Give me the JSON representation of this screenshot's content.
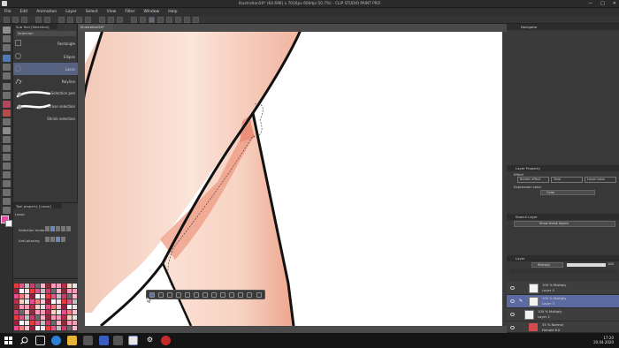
{
  "window": {
    "title": "Illustration50* (64.69K) x 7016px 600dpi 50.7%) - CLIP STUDIO PAINT PRO",
    "controls": [
      "—",
      "□",
      "✕"
    ]
  },
  "menu": [
    "File",
    "Edit",
    "Animation",
    "Layer",
    "Select",
    "View",
    "Filter",
    "Window",
    "Help"
  ],
  "document_tab": "Illustration50*",
  "sub_tool": {
    "tab_label": "Sub Tool [Selection]",
    "header": "Selection",
    "items": [
      {
        "label": "Rectangle",
        "icon": "rectangle-select-icon"
      },
      {
        "label": "Ellipse",
        "icon": "ellipse-select-icon"
      },
      {
        "label": "Lasso",
        "icon": "lasso-select-icon"
      },
      {
        "label": "Polyline",
        "icon": "polyline-select-icon"
      },
      {
        "label": "Selection pen",
        "icon": "selection-pen-icon"
      },
      {
        "label": "Erase selection",
        "icon": "erase-selection-icon"
      },
      {
        "label": "Shrink selection",
        "icon": "shrink-selection-icon"
      }
    ],
    "selected_index": 2
  },
  "tool_property": {
    "tab_label": "Tool property [Lasso]",
    "header": "Lasso",
    "rows": [
      {
        "label": "Selection mode"
      },
      {
        "label": "Anti-aliasing"
      }
    ]
  },
  "right_panel": {
    "navigator_tab": "Navigator",
    "layer_property_tab": "Layer Property",
    "effect_label": "Effect",
    "effect_buttons": [
      "Border effect",
      "Tone",
      "Layer color"
    ],
    "expression_color_label": "Expression color",
    "expression_color_value": "Color",
    "search_layer_tab": "Search Layer",
    "search_layer_dropdown": "Show these layers",
    "layer_tab": "Layer",
    "blend_mode": "Multiply",
    "opacity": "100",
    "layers": [
      {
        "line1": "100 % Multiply",
        "line2": "Layer 4",
        "selected": false
      },
      {
        "line1": "100 % Multiply",
        "line2": "Layer 3",
        "selected": true
      },
      {
        "line1": "100 % Multiply",
        "line2": "Layer 2",
        "selected": false
      },
      {
        "line1": "35 % Normal",
        "line2": "Female 6.0",
        "selected": false
      }
    ]
  },
  "taskbar": {
    "time": "17:20",
    "date": "20.04.2020"
  },
  "colors": {
    "skin": "#f6d2c2",
    "skin_shadow": "#ec9c86",
    "outline": "#111111",
    "layer_selected": "#5b6aa0"
  }
}
